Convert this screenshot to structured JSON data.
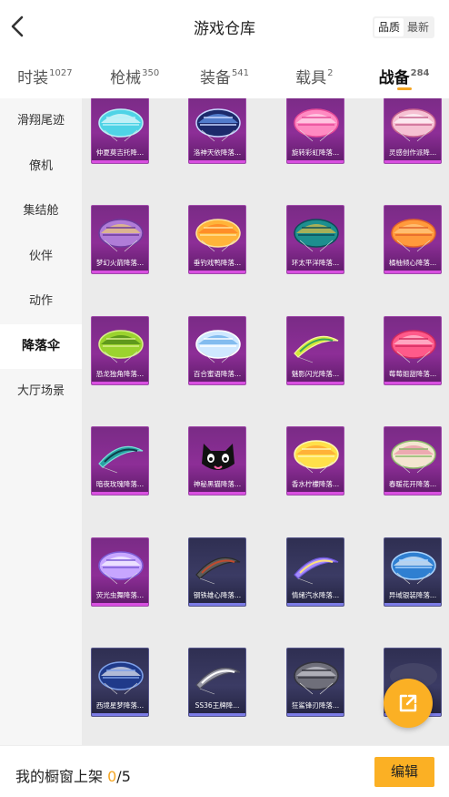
{
  "header": {
    "title": "游戏仓库",
    "sort": [
      {
        "label": "品质",
        "active": true
      },
      {
        "label": "最新",
        "active": false
      }
    ]
  },
  "tabs": [
    {
      "label": "时装",
      "count": "1027",
      "active": false
    },
    {
      "label": "枪械",
      "count": "350",
      "active": false
    },
    {
      "label": "装备",
      "count": "541",
      "active": false
    },
    {
      "label": "载具",
      "count": "2",
      "active": false
    },
    {
      "label": "战备",
      "count": "284",
      "active": true
    }
  ],
  "sidebar": [
    {
      "label": "滑翔尾迹",
      "active": false
    },
    {
      "label": "僚机",
      "active": false
    },
    {
      "label": "集结舱",
      "active": false
    },
    {
      "label": "伙伴",
      "active": false
    },
    {
      "label": "动作",
      "active": false
    },
    {
      "label": "降落伞",
      "active": true
    },
    {
      "label": "大厅场景",
      "active": false
    }
  ],
  "items": [
    {
      "label": "仲夏莫吉托降...",
      "tier": "purple",
      "icon": "parachute-cyan-stripes-icon"
    },
    {
      "label": "洛神天依降落...",
      "tier": "purple",
      "icon": "parachute-navy-floral-icon"
    },
    {
      "label": "旋转彩虹降落...",
      "tier": "purple",
      "icon": "parachute-pink-swirl-icon"
    },
    {
      "label": "灵感创作派降...",
      "tier": "purple",
      "icon": "parachute-pink-doodle-icon"
    },
    {
      "label": "梦幻火箭降落...",
      "tier": "purple",
      "icon": "parachute-rocket-pattern-icon"
    },
    {
      "label": "垂钓戏鸭降落...",
      "tier": "purple",
      "icon": "parachute-orange-duck-icon"
    },
    {
      "label": "环太平洋降落...",
      "tier": "purple",
      "icon": "parachute-teal-mech-icon"
    },
    {
      "label": "橘柚倾心降落...",
      "tier": "purple",
      "icon": "parachute-orange-citrus-icon"
    },
    {
      "label": "恐龙独角降落...",
      "tier": "purple",
      "icon": "parachute-green-dino-icon"
    },
    {
      "label": "百合蜜语降落...",
      "tier": "purple",
      "icon": "parachute-lily-blue-icon"
    },
    {
      "label": "魅影闪光降落...",
      "tier": "purple",
      "icon": "parachute-yellow-green-wing-icon"
    },
    {
      "label": "莓莓姐甜降落...",
      "tier": "purple",
      "icon": "parachute-berry-pink-icon"
    },
    {
      "label": "暗夜玫瑰降落...",
      "tier": "purple",
      "icon": "parachute-dark-teal-wing-icon"
    },
    {
      "label": "神秘黑猫降落...",
      "tier": "purple",
      "icon": "black-cat-parachute-icon"
    },
    {
      "label": "香水柠檬降落...",
      "tier": "purple",
      "icon": "parachute-lemon-icon"
    },
    {
      "label": "春暖花开降落...",
      "tier": "purple",
      "icon": "parachute-spring-flowers-icon"
    },
    {
      "label": "荧光虫舞降落...",
      "tier": "purple",
      "icon": "parachute-lavender-lantern-icon"
    },
    {
      "label": "钢铁雄心降落...",
      "tier": "blue",
      "icon": "parachute-steel-wing-icon"
    },
    {
      "label": "情绪汽水降落...",
      "tier": "blue",
      "icon": "parachute-soda-wing-icon"
    },
    {
      "label": "异域银装降落...",
      "tier": "blue",
      "icon": "parachute-blue-ornate-icon"
    },
    {
      "label": "西境星梦降落...",
      "tier": "blue",
      "icon": "parachute-navy-star-icon"
    },
    {
      "label": "SS36王牌降...",
      "tier": "blue",
      "icon": "parachute-silver-square-icon"
    },
    {
      "label": "狂鲨锋刃降落...",
      "tier": "blue",
      "icon": "parachute-gray-shark-icon"
    },
    {
      "label": "",
      "tier": "blue",
      "icon": "parachute-partial-icon"
    }
  ],
  "footer": {
    "prefix": "我的橱窗上架",
    "current": "0",
    "slash": "/",
    "max": "5",
    "edit_label": "编辑"
  },
  "colors": {
    "accent": "#fbb024",
    "purple_tier": "#8d2e97",
    "blue_tier": "#3b3b64"
  }
}
